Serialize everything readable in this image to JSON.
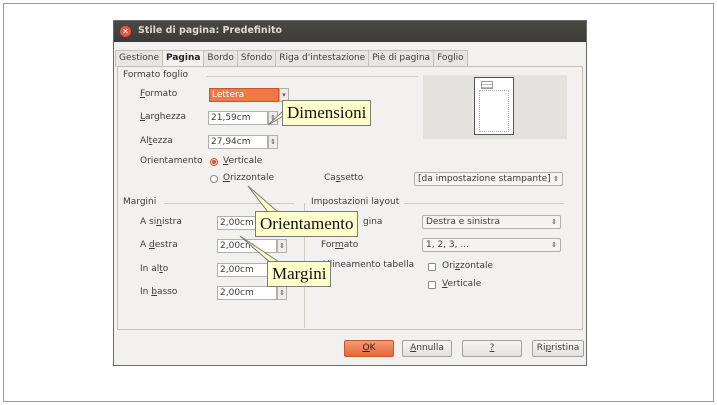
{
  "window": {
    "title": "Stile di pagina: Predefinito"
  },
  "tabs": [
    "Gestione",
    "Pagina",
    "Bordo",
    "Sfondo",
    "Riga d'intestazione",
    "Piè di pagina",
    "Foglio"
  ],
  "active_tab": "Pagina",
  "paper_format": {
    "section_title": "Formato foglio",
    "format_label_u": "F",
    "format_label_rest": "ormato",
    "format_value": "Lettera",
    "width_label_u": "L",
    "width_label_rest": "arghezza",
    "width_value": "21,59cm",
    "height_label_pre": "Al",
    "height_label_u": "t",
    "height_label_rest": "ezza",
    "height_value": "27,94cm",
    "orientation_label": "Orientamento",
    "portrait_u": "V",
    "portrait_rest": "erticale",
    "landscape_u": "O",
    "landscape_rest": "rizzontale",
    "tray_label_pre": "Ca",
    "tray_label_u": "s",
    "tray_label_rest": "setto",
    "tray_value": "[da impostazione stampante]"
  },
  "margins": {
    "section_title": "Margini",
    "left_pre": "A si",
    "left_u": "n",
    "left_rest": "istra",
    "left_value": "2,00cm",
    "right_pre": "A ",
    "right_u": "d",
    "right_rest": "estra",
    "right_value": "2,00cm",
    "top_pre": "In al",
    "top_u": "t",
    "top_rest": "o",
    "top_value": "2,00cm",
    "bottom_pre": "In ",
    "bottom_u": "b",
    "bottom_rest": "asso",
    "bottom_value": "2,00cm"
  },
  "layout_settings": {
    "section_title": "Impostazioni layout",
    "page_layout_label": "gina",
    "page_layout_value": "Destra e sinistra",
    "format_label_pre": "For",
    "format_label_u": "m",
    "format_label_rest": "ato",
    "format_value": "1, 2, 3, ...",
    "table_alignment_label": "Allineamento tabella",
    "align_horizontal_pre": "Ori",
    "align_horizontal_u": "z",
    "align_horizontal_rest": "zontale",
    "align_vertical_u": "V",
    "align_vertical_rest": "erticale"
  },
  "buttons": {
    "ok_u": "O",
    "ok_rest": "K",
    "cancel_u": "A",
    "cancel_rest": "nnulla",
    "help_u": "?",
    "reset_pre": "Ri",
    "reset_u": "p",
    "reset_rest": "ristina"
  },
  "callouts": {
    "dimensions": "Dimensioni",
    "orientation": "Orientamento",
    "margins": "Margini"
  },
  "colors": {
    "accent": "#f07746",
    "titlebar": "#3c3b37",
    "callout_bg": "#ffffcc"
  }
}
